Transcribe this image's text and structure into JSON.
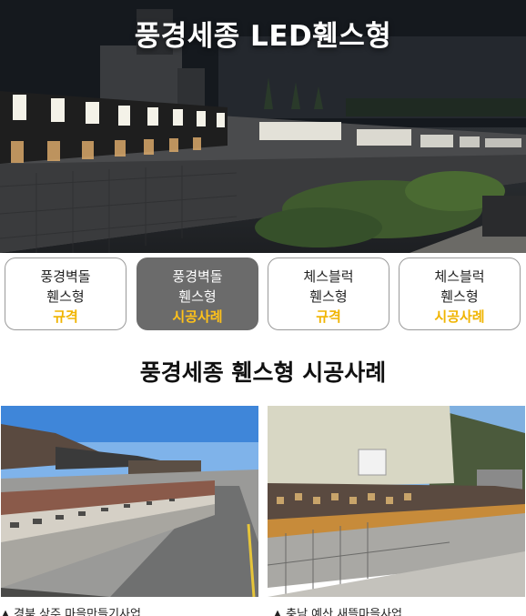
{
  "hero": {
    "title": "풍경세종 LED휀스형"
  },
  "tabs": [
    {
      "line1": "풍경벽돌",
      "line2": "휀스형",
      "line3": "규격",
      "active": false
    },
    {
      "line1": "풍경벽돌",
      "line2": "휀스형",
      "line3": "시공사례",
      "active": true
    },
    {
      "line1": "체스블럭",
      "line2": "휀스형",
      "line3": "규격",
      "active": false
    },
    {
      "line1": "체스블럭",
      "line2": "휀스형",
      "line3": "시공사례",
      "active": false
    }
  ],
  "section": {
    "title": "풍경세종 휀스형 시공사례"
  },
  "photos": [
    {
      "caption": "▲ 경북 상주 마을만들기사업"
    },
    {
      "caption": "▲ 충남 예산 새뜰마을사업"
    }
  ],
  "colors": {
    "accent": "#f0b400",
    "active_tab_bg": "#6b6b6b",
    "border": "#9a9a9a"
  }
}
